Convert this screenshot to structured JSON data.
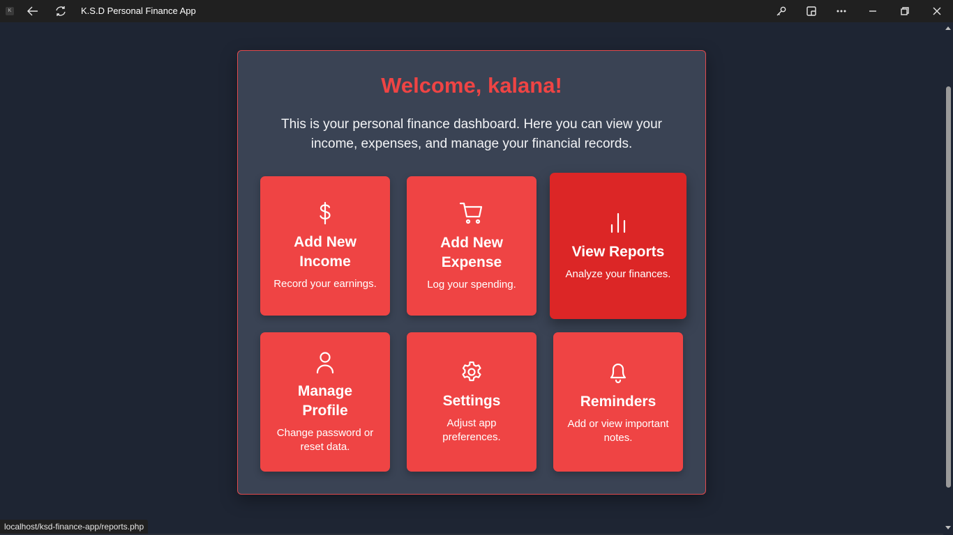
{
  "window": {
    "title": "K.S.D Personal Finance App",
    "app_icon_letter": "K"
  },
  "dashboard": {
    "welcome": "Welcome, kalana!",
    "intro": "This is your personal finance dashboard. Here you can view your income, expenses, and manage your financial records.",
    "tiles": [
      {
        "title": "Add New Income",
        "desc": "Record your earnings.",
        "icon": "dollar-icon"
      },
      {
        "title": "Add New Expense",
        "desc": "Log your spending.",
        "icon": "cart-icon"
      },
      {
        "title": "View Reports",
        "desc": "Analyze your finances.",
        "icon": "bar-chart-icon"
      },
      {
        "title": "Manage Profile",
        "desc": "Change password or reset data.",
        "icon": "user-icon"
      },
      {
        "title": "Settings",
        "desc": "Adjust app preferences.",
        "icon": "gear-icon"
      },
      {
        "title": "Reminders",
        "desc": "Add or view important notes.",
        "icon": "bell-icon"
      }
    ]
  },
  "status": {
    "url": "localhost/ksd-finance-app/reports.php"
  },
  "colors": {
    "accent": "#ef4444",
    "accent_hover": "#dc2626",
    "card_bg": "#3a4354",
    "page_bg": "#1e2533"
  }
}
